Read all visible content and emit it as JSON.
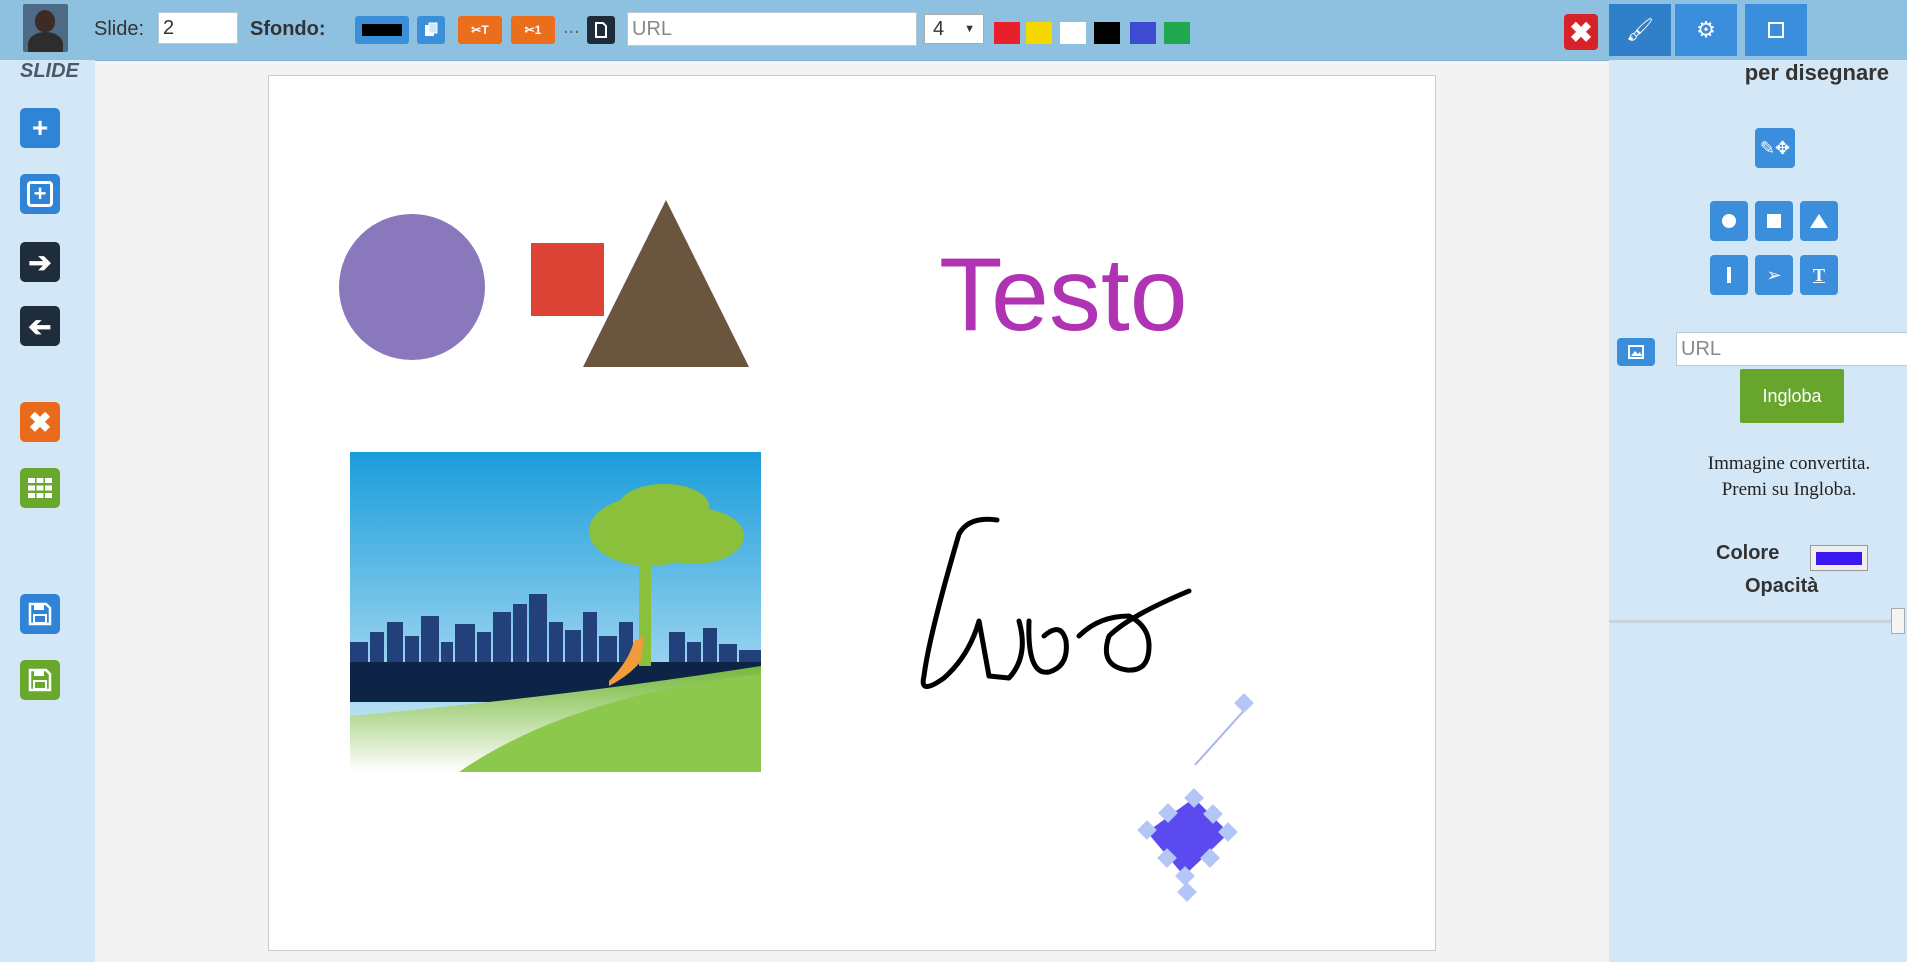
{
  "topbar": {
    "slide_label": "Slide:",
    "slide_value": "2",
    "sfondo_label": "Sfondo:",
    "cut_text_label": "✂T",
    "cut_one_label": "✂1",
    "ellipsis": "...",
    "url_placeholder": "URL",
    "size_value": "4",
    "palette": [
      "#e8202a",
      "#f5d800",
      "#ffffff",
      "#000000",
      "#3d4bd1",
      "#1fa84e"
    ],
    "close_label": "✖"
  },
  "leftbar": {
    "title": "SLIDE",
    "buttons": [
      "add-slide",
      "add-slide-box",
      "next-slide",
      "previous-slide",
      "delete-slide",
      "grid-view",
      "save",
      "save-as"
    ]
  },
  "canvas": {
    "text_object": "Testo",
    "handwriting_color": "#000000",
    "circle_color": "#8a78bd",
    "square_color": "#dd4335",
    "triangle_color": "#6a553f",
    "text_color": "#b033b4",
    "selected_shape_color": "#5a4af0"
  },
  "rightbar": {
    "heading": "per disegnare",
    "url_placeholder": "URL",
    "ingloba_label": "Ingloba",
    "info_line1": "Immagine convertita.",
    "info_line2": "Premi su Ingloba.",
    "colore_label": "Colore",
    "colore_value": "#3c18f0",
    "opacita_label": "Opacità"
  }
}
